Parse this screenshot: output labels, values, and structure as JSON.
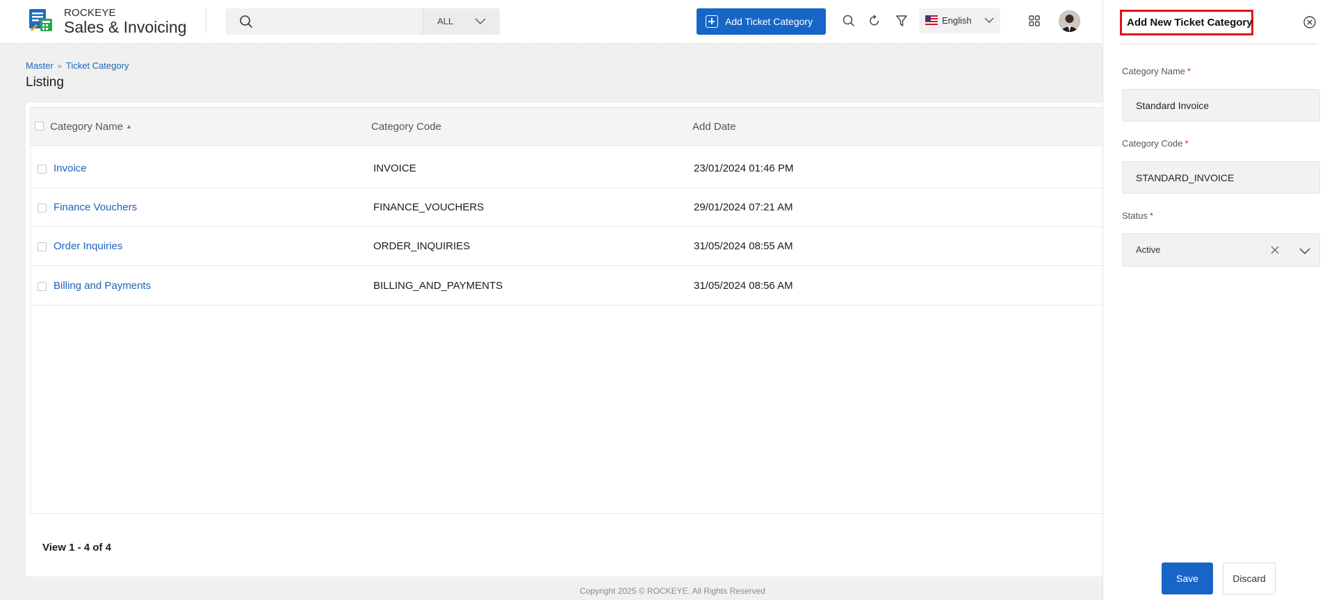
{
  "app": {
    "brand_top": "ROCKEYE",
    "brand_main": "Sales & Invoicing"
  },
  "header": {
    "search_placeholder": "",
    "search_scope": "ALL",
    "add_button_label": "Add Ticket Category",
    "language": "English",
    "icons": [
      "search-icon",
      "refresh-icon",
      "filter-icon",
      "apps-grid-icon"
    ]
  },
  "breadcrumb": {
    "items": [
      "Master",
      "Ticket Category"
    ]
  },
  "page": {
    "title": "Listing"
  },
  "table": {
    "columns": [
      "Category Name",
      "Category Code",
      "Add Date"
    ],
    "rows": [
      {
        "name": "Invoice",
        "code": "INVOICE",
        "date": "23/01/2024 01:46 PM"
      },
      {
        "name": "Finance Vouchers",
        "code": "FINANCE_VOUCHERS",
        "date": "29/01/2024 07:21 AM"
      },
      {
        "name": "Order Inquiries",
        "code": "ORDER_INQUIRIES",
        "date": "31/05/2024 08:55 AM"
      },
      {
        "name": "Billing and Payments",
        "code": "BILLING_AND_PAYMENTS",
        "date": "31/05/2024 08:56 AM"
      }
    ],
    "pager_text": "View 1 - 4 of 4"
  },
  "footer": {
    "copyright": "Copyright 2025 © ROCKEYE. All Rights Reserved"
  },
  "panel": {
    "title": "Add New Ticket Category",
    "fields": {
      "category_name_label": "Category Name",
      "category_name_value": "Standard Invoice",
      "category_code_label": "Category Code",
      "category_code_value": "STANDARD_INVOICE",
      "status_label": "Status",
      "status_value": "Active",
      "required_mark": "*"
    },
    "save_label": "Save",
    "discard_label": "Discard"
  },
  "colors": {
    "primary": "#1765c7",
    "link": "#1d62b9",
    "highlight_border": "#e0101a",
    "required": "#d2232a"
  }
}
